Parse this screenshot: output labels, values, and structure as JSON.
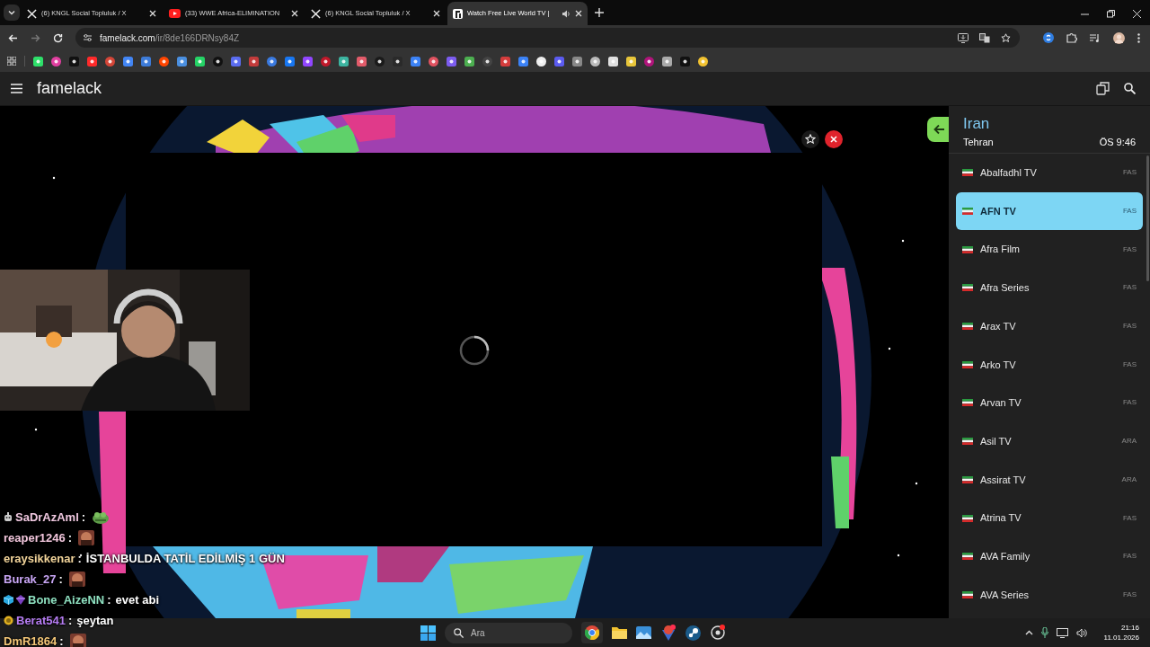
{
  "browser": {
    "tabs": [
      {
        "kind": "x",
        "title": "(6) KNGL Social Topluluk / X",
        "selected": false,
        "audio": false
      },
      {
        "kind": "youtube",
        "title": "(33) WWE Africa-ELIMINATION",
        "selected": false,
        "audio": false
      },
      {
        "kind": "x",
        "title": "(6) KNGL Social Topluluk / X",
        "selected": false,
        "audio": false
      },
      {
        "kind": "famelack",
        "title": "Watch Free Live World TV |",
        "selected": true,
        "audio": true
      }
    ],
    "address": {
      "domain": "famelack.com",
      "path": "/ir/8de166DRNsy84Z"
    }
  },
  "app": {
    "title": "famelack"
  },
  "sidebar": {
    "country": "Iran",
    "city": "Tehran",
    "time": "ÖS 9:46",
    "channels": [
      {
        "name": "Abalfadhl TV",
        "lang": "FAS",
        "selected": false
      },
      {
        "name": "AFN TV",
        "lang": "FAS",
        "selected": true
      },
      {
        "name": "Afra Film",
        "lang": "FAS",
        "selected": false
      },
      {
        "name": "Afra Series",
        "lang": "FAS",
        "selected": false
      },
      {
        "name": "Arax TV",
        "lang": "FAS",
        "selected": false
      },
      {
        "name": "Arko TV",
        "lang": "FAS",
        "selected": false
      },
      {
        "name": "Arvan TV",
        "lang": "FAS",
        "selected": false
      },
      {
        "name": "Asil TV",
        "lang": "ARA",
        "selected": false
      },
      {
        "name": "Assirat TV",
        "lang": "ARA",
        "selected": false
      },
      {
        "name": "Atrina TV",
        "lang": "FAS",
        "selected": false
      },
      {
        "name": "AVA Family",
        "lang": "FAS",
        "selected": false
      },
      {
        "name": "AVA Series",
        "lang": "FAS",
        "selected": false
      }
    ]
  },
  "chat": [
    {
      "badges": [
        {
          "kind": "robot"
        }
      ],
      "user": "SaDrAzAml",
      "color": "#f0c8e0",
      "separator": ":",
      "emote": {
        "kind": "frog"
      }
    },
    {
      "user": "reaper1246",
      "color": "#f2c6dc",
      "separator": ":",
      "emote": {
        "kind": "face"
      }
    },
    {
      "user": "eraysikkenar",
      "color": "#f2d49a",
      "separator": ":",
      "message": "İSTANBULDA TATİL EDİLMİŞ 1 GÜN"
    },
    {
      "user": "Burak_27",
      "color": "#c9a6f5",
      "separator": ":",
      "emote": {
        "kind": "face"
      }
    },
    {
      "badges": [
        {
          "kind": "cube"
        },
        {
          "kind": "gem"
        }
      ],
      "user": "Bone_AizeNN",
      "color": "#8ee0c0",
      "separator": ":",
      "message": "evet abi"
    },
    {
      "badges": [
        {
          "kind": "coin"
        }
      ],
      "user": "Berat541",
      "color": "#b57cf2",
      "separator": ":",
      "message": "şeytan"
    },
    {
      "user": "DmR1864",
      "color": "#f5c878",
      "separator": ":",
      "emote": {
        "kind": "face"
      }
    }
  ],
  "taskbar": {
    "search_placeholder": "Ara",
    "time": "21:16",
    "date": "11.01.2026"
  }
}
